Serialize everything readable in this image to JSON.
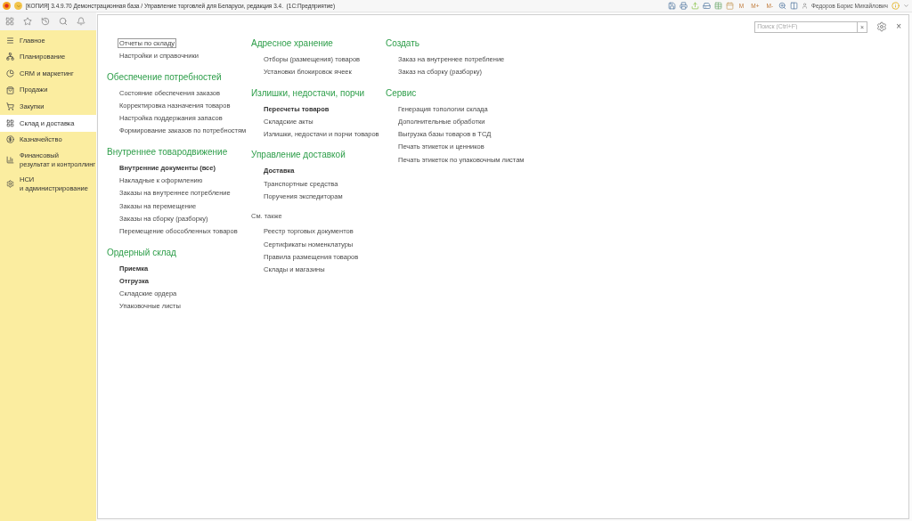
{
  "window": {
    "title": "[КОПИЯ] 3.4.9.70 Демонстрационная база / Управление торговлей для Беларуси, редакция 3.4.  (1С:Предприятие)"
  },
  "titlebar_tools": {
    "memory": [
      "M",
      "M+",
      "M-"
    ],
    "user": "Федоров Борис Михайлович"
  },
  "sidebar": {
    "items": [
      {
        "label": "Главное",
        "selected": false
      },
      {
        "label": "Планирование",
        "selected": false
      },
      {
        "label": "CRM и маркетинг",
        "selected": false
      },
      {
        "label": "Продажи",
        "selected": false
      },
      {
        "label": "Закупки",
        "selected": false
      },
      {
        "label": "Склад и доставка",
        "selected": true
      },
      {
        "label": "Казначейство",
        "selected": false
      },
      {
        "label": "Финансовый\nрезультат и контроллинг",
        "selected": false
      },
      {
        "label": "НСИ\nи администрирование",
        "selected": false
      }
    ]
  },
  "search": {
    "placeholder": "Поиск (Ctrl+F)",
    "clear": "×"
  },
  "close": "×",
  "columns": [
    [
      {
        "kind": "links",
        "items": [
          {
            "label": "Отчеты по складу",
            "bold": false,
            "focused": true
          },
          {
            "label": "Настройки и справочники",
            "bold": false,
            "focused": false
          }
        ]
      },
      {
        "kind": "group",
        "heading": "Обеспечение потребностей",
        "items": [
          {
            "label": "Состояние обеспечения заказов",
            "bold": false,
            "focused": false
          },
          {
            "label": "Корректировка назначения товаров",
            "bold": false,
            "focused": false
          },
          {
            "label": "Настройка поддержания запасов",
            "bold": false,
            "focused": false
          },
          {
            "label": "Формирование заказов по потребностям",
            "bold": false,
            "focused": false
          }
        ]
      },
      {
        "kind": "group",
        "heading": "Внутреннее товародвижение",
        "items": [
          {
            "label": "Внутренние документы (все)",
            "bold": true,
            "focused": false
          },
          {
            "label": "Накладные к оформлению",
            "bold": false,
            "focused": false
          },
          {
            "label": "Заказы на внутреннее потребление",
            "bold": false,
            "focused": false
          },
          {
            "label": "Заказы на перемещение",
            "bold": false,
            "focused": false
          },
          {
            "label": "Заказы на сборку (разборку)",
            "bold": false,
            "focused": false
          },
          {
            "label": "Перемещение обособленных товаров",
            "bold": false,
            "focused": false
          }
        ]
      },
      {
        "kind": "group",
        "heading": "Ордерный склад",
        "items": [
          {
            "label": "Приемка",
            "bold": true,
            "focused": false
          },
          {
            "label": "Отгрузка",
            "bold": true,
            "focused": false
          },
          {
            "label": "Складские ордера",
            "bold": false,
            "focused": false
          },
          {
            "label": "Упаковочные листы",
            "bold": false,
            "focused": false
          }
        ]
      }
    ],
    [
      {
        "kind": "group",
        "heading": "Адресное хранение",
        "items": [
          {
            "label": "Отборы (размещения) товаров",
            "bold": false,
            "focused": false
          },
          {
            "label": "Установки блокировок ячеек",
            "bold": false,
            "focused": false
          }
        ]
      },
      {
        "kind": "group",
        "heading": "Излишки, недостачи, порчи",
        "items": [
          {
            "label": "Пересчеты товаров",
            "bold": true,
            "focused": false
          },
          {
            "label": "Складские акты",
            "bold": false,
            "focused": false
          },
          {
            "label": "Излишки, недостачи и порчи товаров",
            "bold": false,
            "focused": false
          }
        ]
      },
      {
        "kind": "group",
        "heading": "Управление доставкой",
        "items": [
          {
            "label": "Доставка",
            "bold": true,
            "focused": false
          },
          {
            "label": "Транспортные средства",
            "bold": false,
            "focused": false
          },
          {
            "label": "Поручения экспедиторам",
            "bold": false,
            "focused": false
          }
        ]
      },
      {
        "kind": "see_also",
        "heading": "См. также",
        "items": [
          {
            "label": "Реестр торговых документов",
            "bold": false,
            "focused": false
          },
          {
            "label": "Сертификаты номенклатуры",
            "bold": false,
            "focused": false
          },
          {
            "label": "Правила размещения товаров",
            "bold": false,
            "focused": false
          },
          {
            "label": "Склады и магазины",
            "bold": false,
            "focused": false
          }
        ]
      }
    ],
    [
      {
        "kind": "group",
        "heading": "Создать",
        "items": [
          {
            "label": "Заказ на внутреннее потребление",
            "bold": false,
            "focused": false
          },
          {
            "label": "Заказ на сборку (разборку)",
            "bold": false,
            "focused": false
          }
        ]
      },
      {
        "kind": "group",
        "heading": "Сервис",
        "items": [
          {
            "label": "Генерация топологии склада",
            "bold": false,
            "focused": false
          },
          {
            "label": "Дополнительные обработки",
            "bold": false,
            "focused": false
          },
          {
            "label": "Выгрузка базы товаров в ТСД",
            "bold": false,
            "focused": false
          },
          {
            "label": "Печать этикеток и ценников",
            "bold": false,
            "focused": false
          },
          {
            "label": "Печать этикеток по упаковочным листам",
            "bold": false,
            "focused": false
          }
        ]
      }
    ]
  ]
}
